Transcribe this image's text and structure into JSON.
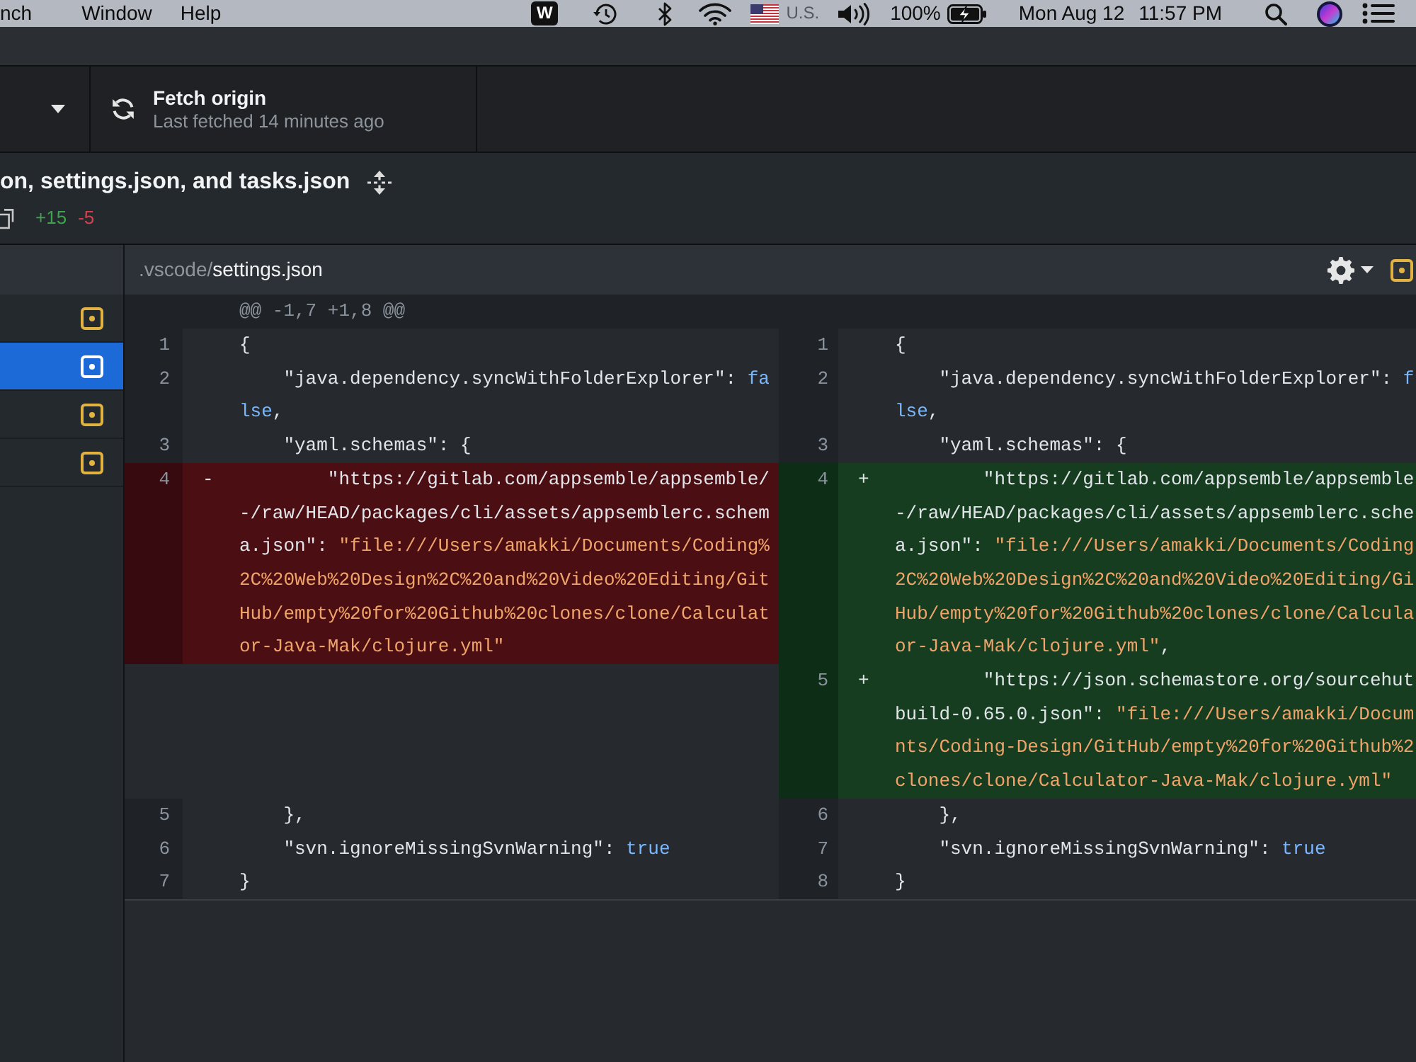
{
  "menu_bar": {
    "menus": [
      "nch",
      "Window",
      "Help"
    ],
    "app_icon_letter": "W",
    "input_source": "U.S.",
    "battery": "100%",
    "date": "Mon Aug 12",
    "time": "11:57 PM"
  },
  "toolbar": {
    "fetch": {
      "title": "Fetch origin",
      "subtitle": "Last fetched 14 minutes ago"
    }
  },
  "commit": {
    "title": "on, settings.json, and tasks.json",
    "additions": "+15",
    "deletions": "-5"
  },
  "sidebar": {
    "files": [
      {
        "selected": false
      },
      {
        "selected": true
      },
      {
        "selected": false
      },
      {
        "selected": false
      }
    ]
  },
  "file_header": {
    "directory": ".vscode/",
    "filename": "settings.json"
  },
  "diff": {
    "hunk_header": "@@ -1,7 +1,8 @@",
    "lines": [
      {
        "left": {
          "number": "1",
          "kind": "context",
          "rows": [
            [
              {
                "text": "{",
                "kind": "text"
              }
            ]
          ]
        },
        "right": {
          "number": "1",
          "kind": "context",
          "rows": [
            [
              {
                "text": "{",
                "kind": "text"
              }
            ]
          ]
        }
      },
      {
        "left": {
          "number": "2",
          "kind": "context",
          "rows": [
            [
              {
                "text": "    \"java.dependency.syncWithFolderExplorer\": ",
                "kind": "text"
              },
              {
                "text": "fa",
                "kind": "literal"
              }
            ],
            [
              {
                "text": "lse",
                "kind": "literal"
              },
              {
                "text": ",",
                "kind": "text"
              }
            ]
          ]
        },
        "right": {
          "number": "2",
          "kind": "context",
          "rows": [
            [
              {
                "text": "    \"java.dependency.syncWithFolderExplorer\": ",
                "kind": "text"
              },
              {
                "text": "f",
                "kind": "literal"
              }
            ],
            [
              {
                "text": "lse",
                "kind": "literal"
              },
              {
                "text": ",",
                "kind": "text"
              }
            ]
          ]
        }
      },
      {
        "left": {
          "number": "3",
          "kind": "context",
          "rows": [
            [
              {
                "text": "    \"yaml.schemas\": {",
                "kind": "text"
              }
            ]
          ]
        },
        "right": {
          "number": "3",
          "kind": "context",
          "rows": [
            [
              {
                "text": "    \"yaml.schemas\": {",
                "kind": "text"
              }
            ]
          ]
        }
      },
      {
        "left": {
          "number": "4",
          "kind": "deleted",
          "marker": "-",
          "rows": [
            [
              {
                "text": "        \"https://gitlab.com/appsemble/appsemble/",
                "kind": "text"
              }
            ],
            [
              {
                "text": "-/raw/HEAD/packages/cli/assets/appsemblerc.schem",
                "kind": "text"
              }
            ],
            [
              {
                "text": "a.json\": ",
                "kind": "text"
              },
              {
                "text": "\"file:///Users/amakki/Documents/Coding%",
                "kind": "string"
              }
            ],
            [
              {
                "text": "2C%20Web%20Design%2C%20and%20Video%20Editing/Git",
                "kind": "string"
              }
            ],
            [
              {
                "text": "Hub/empty%20for%20Github%20clones/clone/Calculat",
                "kind": "string"
              }
            ],
            [
              {
                "text": "or-Java-Mak/clojure.yml\"",
                "kind": "string"
              }
            ]
          ]
        },
        "right": {
          "number": "4",
          "kind": "added",
          "marker": "+",
          "rows": [
            [
              {
                "text": "        \"https://gitlab.com/appsemble/appsemble",
                "kind": "text"
              }
            ],
            [
              {
                "text": "-/raw/HEAD/packages/cli/assets/appsemblerc.sche",
                "kind": "text"
              }
            ],
            [
              {
                "text": "a.json\": ",
                "kind": "text"
              },
              {
                "text": "\"file:///Users/amakki/Documents/Coding",
                "kind": "string"
              }
            ],
            [
              {
                "text": "2C%20Web%20Design%2C%20and%20Video%20Editing/Gi",
                "kind": "string"
              }
            ],
            [
              {
                "text": "Hub/empty%20for%20Github%20clones/clone/Calcula",
                "kind": "string"
              }
            ],
            [
              {
                "text": "or-Java-Mak/clojure.yml\"",
                "kind": "string"
              },
              {
                "text": ",",
                "kind": "text"
              }
            ]
          ]
        }
      },
      {
        "right": {
          "number": "5",
          "kind": "added",
          "marker": "+",
          "rows": [
            [
              {
                "text": "        \"https://json.schemastore.org/sourcehut",
                "kind": "text"
              }
            ],
            [
              {
                "text": "build-0.65.0.json\": ",
                "kind": "text"
              },
              {
                "text": "\"file:///Users/amakki/Docum",
                "kind": "string"
              }
            ],
            [
              {
                "text": "nts/Coding-Design/GitHub/empty%20for%20Github%2",
                "kind": "string"
              }
            ],
            [
              {
                "text": "clones/clone/Calculator-Java-Mak/clojure.yml\"",
                "kind": "string"
              }
            ]
          ]
        }
      },
      {
        "left": {
          "number": "5",
          "kind": "context",
          "rows": [
            [
              {
                "text": "    },",
                "kind": "text"
              }
            ]
          ]
        },
        "right": {
          "number": "6",
          "kind": "context",
          "rows": [
            [
              {
                "text": "    },",
                "kind": "text"
              }
            ]
          ]
        }
      },
      {
        "left": {
          "number": "6",
          "kind": "context",
          "rows": [
            [
              {
                "text": "    \"svn.ignoreMissingSvnWarning\": ",
                "kind": "text"
              },
              {
                "text": "true",
                "kind": "literal"
              }
            ]
          ]
        },
        "right": {
          "number": "7",
          "kind": "context",
          "rows": [
            [
              {
                "text": "    \"svn.ignoreMissingSvnWarning\": ",
                "kind": "text"
              },
              {
                "text": "true",
                "kind": "literal"
              }
            ]
          ]
        }
      },
      {
        "left": {
          "number": "7",
          "kind": "context",
          "rows": [
            [
              {
                "text": "}",
                "kind": "text"
              }
            ]
          ]
        },
        "right": {
          "number": "8",
          "kind": "context",
          "rows": [
            [
              {
                "text": "}",
                "kind": "text"
              }
            ]
          ]
        }
      }
    ]
  }
}
